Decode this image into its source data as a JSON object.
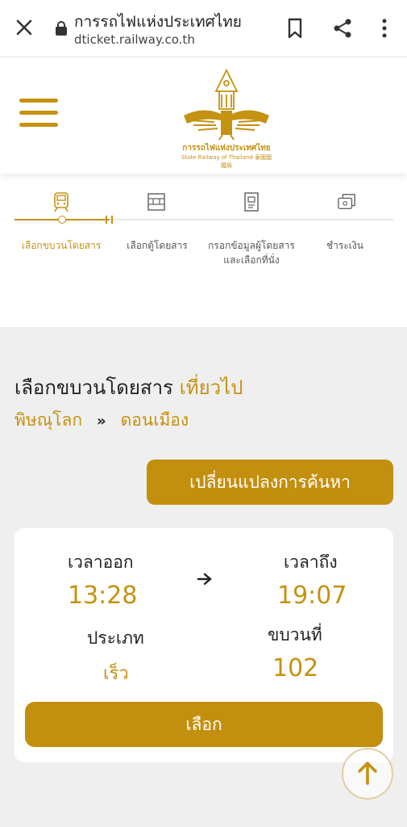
{
  "browser": {
    "title": "การรถไฟแห่งประเทศไทย",
    "url": "dticket.railway.co.th"
  },
  "header": {
    "logo_text_th": "การรถไฟแห่งประเทศไทย",
    "logo_text_en": "State Railway of Thailand 泰國國鐵局"
  },
  "steps": [
    {
      "label": "เลือกขบวนโดยสาร",
      "icon": "train-icon",
      "active": true
    },
    {
      "label": "เลือกตู้โดยสาร",
      "icon": "carriage-icon",
      "active": false
    },
    {
      "label": "กรอกข้อมูลผู้โดยสารและเลือกที่นั่ง",
      "icon": "form-icon",
      "active": false
    },
    {
      "label": "ชำระเงิน",
      "icon": "payment-icon",
      "active": false
    }
  ],
  "main": {
    "heading": "เลือกขบวนโดยสาร",
    "trip_type": "เที่ยวไป",
    "origin": "พิษณุโลก",
    "route_arrow": "»",
    "destination": "ดอนเมือง",
    "change_search_label": "เปลี่ยนแปลงการค้นหา"
  },
  "train": {
    "depart_label": "เวลาออก",
    "depart_time": "13:28",
    "arrive_label": "เวลาถึง",
    "arrive_time": "19:07",
    "type_label": "ประเภท",
    "type_value": "เร็ว",
    "number_label": "ขบวนที่",
    "number_value": "102",
    "select_label": "เลือก"
  },
  "colors": {
    "accent": "#c59211",
    "button": "#c38f0e",
    "background": "#efefef"
  }
}
